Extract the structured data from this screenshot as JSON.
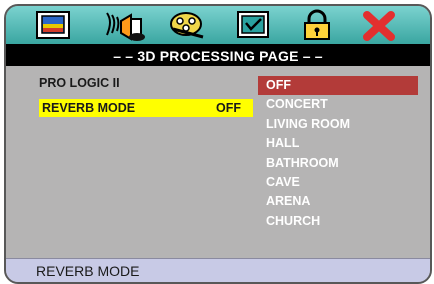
{
  "top_icons": [
    {
      "name": "general-setup-icon",
      "selected": false
    },
    {
      "name": "speaker-3d-icon",
      "selected": true
    },
    {
      "name": "video-reel-icon",
      "selected": false
    },
    {
      "name": "preference-check-icon",
      "selected": false
    },
    {
      "name": "lock-icon",
      "selected": false
    },
    {
      "name": "close-x-icon",
      "selected": false
    }
  ],
  "page": {
    "title": "– – 3D PROCESSING PAGE – –"
  },
  "settings": {
    "pro_logic_label": "PRO LOGIC II",
    "reverb_label": "REVERB MODE",
    "reverb_value": "OFF"
  },
  "options": [
    "OFF",
    "CONCERT",
    "LIVING ROOM",
    "HALL",
    "BATHROOM",
    "CAVE",
    "ARENA",
    "CHURCH"
  ],
  "selected_option": "OFF",
  "status": {
    "text": "REVERB MODE"
  },
  "colors": {
    "icon_bar": "#3aa6a1",
    "highlight_yellow": "#ffff00",
    "selection_red": "#b33b39",
    "panel_gray": "#b5b4b4",
    "status_bg": "#c8cae6"
  }
}
